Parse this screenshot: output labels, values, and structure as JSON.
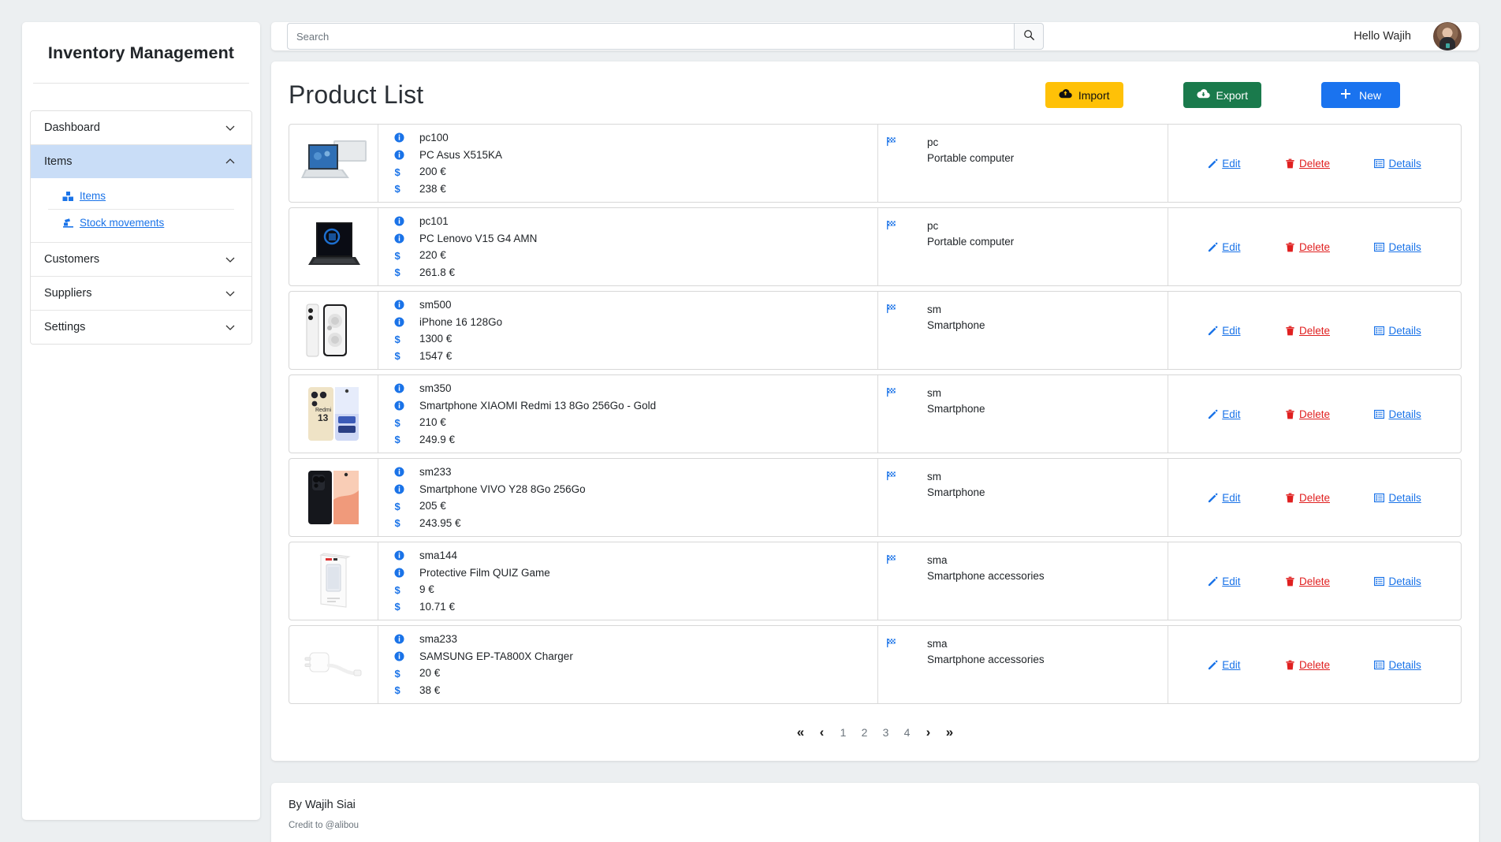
{
  "app": {
    "brand": "Inventory Management"
  },
  "sidebar": {
    "groups": [
      {
        "label": "Dashboard",
        "expanded": false,
        "icon": "chevron-down-icon"
      },
      {
        "label": "Items",
        "expanded": true,
        "icon": "chevron-up-icon",
        "children": [
          {
            "label": "Items",
            "icon": "boxes-icon"
          },
          {
            "label": "Stock movements",
            "icon": "truck-loading-icon"
          }
        ]
      },
      {
        "label": "Customers",
        "expanded": false,
        "icon": "chevron-down-icon"
      },
      {
        "label": "Suppliers",
        "expanded": false,
        "icon": "chevron-down-icon"
      },
      {
        "label": "Settings",
        "expanded": false,
        "icon": "chevron-down-icon"
      }
    ]
  },
  "topbar": {
    "search_placeholder": "Search",
    "search_value": "",
    "search_icon": "search-icon",
    "greeting": "Hello Wajih",
    "avatar_alt": "user-avatar"
  },
  "main": {
    "title": "Product List",
    "buttons": {
      "import": {
        "label": "Import",
        "icon": "cloud-upload-icon",
        "color": "#ffc107"
      },
      "export": {
        "label": "Export",
        "icon": "cloud-download-icon",
        "color": "#1a7a4c"
      },
      "new": {
        "label": "New",
        "icon": "plus-icon",
        "color": "#1a73ef"
      }
    },
    "row_actions": {
      "edit": {
        "label": "Edit",
        "icon": "pencil-icon",
        "color": "#1a73e8"
      },
      "delete": {
        "label": "Delete",
        "icon": "trash-icon",
        "color": "#e02020"
      },
      "details": {
        "label": "Details",
        "icon": "list-alt-icon",
        "color": "#1a73e8"
      }
    },
    "products": [
      {
        "image": "laptop-asus",
        "code": "pc100",
        "name": "PC Asus X515KA",
        "price": "200 €",
        "price_ttc": "238 €",
        "category_code": "pc",
        "category_name": "Portable computer"
      },
      {
        "image": "laptop-lenovo",
        "code": "pc101",
        "name": "PC Lenovo V15 G4 AMN",
        "price": "220 €",
        "price_ttc": "261.8 €",
        "category_code": "pc",
        "category_name": "Portable computer"
      },
      {
        "image": "phone-iphone",
        "code": "sm500",
        "name": "iPhone 16 128Go",
        "price": "1300 €",
        "price_ttc": "1547 €",
        "category_code": "sm",
        "category_name": "Smartphone"
      },
      {
        "image": "phone-redmi",
        "code": "sm350",
        "name": "Smartphone XIAOMI Redmi 13 8Go 256Go - Gold",
        "price": "210 €",
        "price_ttc": "249.9 €",
        "category_code": "sm",
        "category_name": "Smartphone"
      },
      {
        "image": "phone-vivo",
        "code": "sm233",
        "name": "Smartphone VIVO Y28 8Go 256Go",
        "price": "205 €",
        "price_ttc": "243.95 €",
        "category_code": "sm",
        "category_name": "Smartphone"
      },
      {
        "image": "box-film",
        "code": "sma144",
        "name": "Protective Film QUIZ Game",
        "price": "9 €",
        "price_ttc": "10.71 €",
        "category_code": "sma",
        "category_name": "Smartphone accessories"
      },
      {
        "image": "charger",
        "code": "sma233",
        "name": "SAMSUNG EP-TA800X Charger",
        "price": "20 €",
        "price_ttc": "38 €",
        "category_code": "sma",
        "category_name": "Smartphone accessories"
      }
    ],
    "pagination": {
      "first": "«",
      "prev": "‹",
      "next": "›",
      "last": "»",
      "pages": [
        "1",
        "2",
        "3",
        "4"
      ],
      "current": "1"
    }
  },
  "footer": {
    "line1": "By Wajih Siai",
    "line2": "Credit to @alibou"
  }
}
